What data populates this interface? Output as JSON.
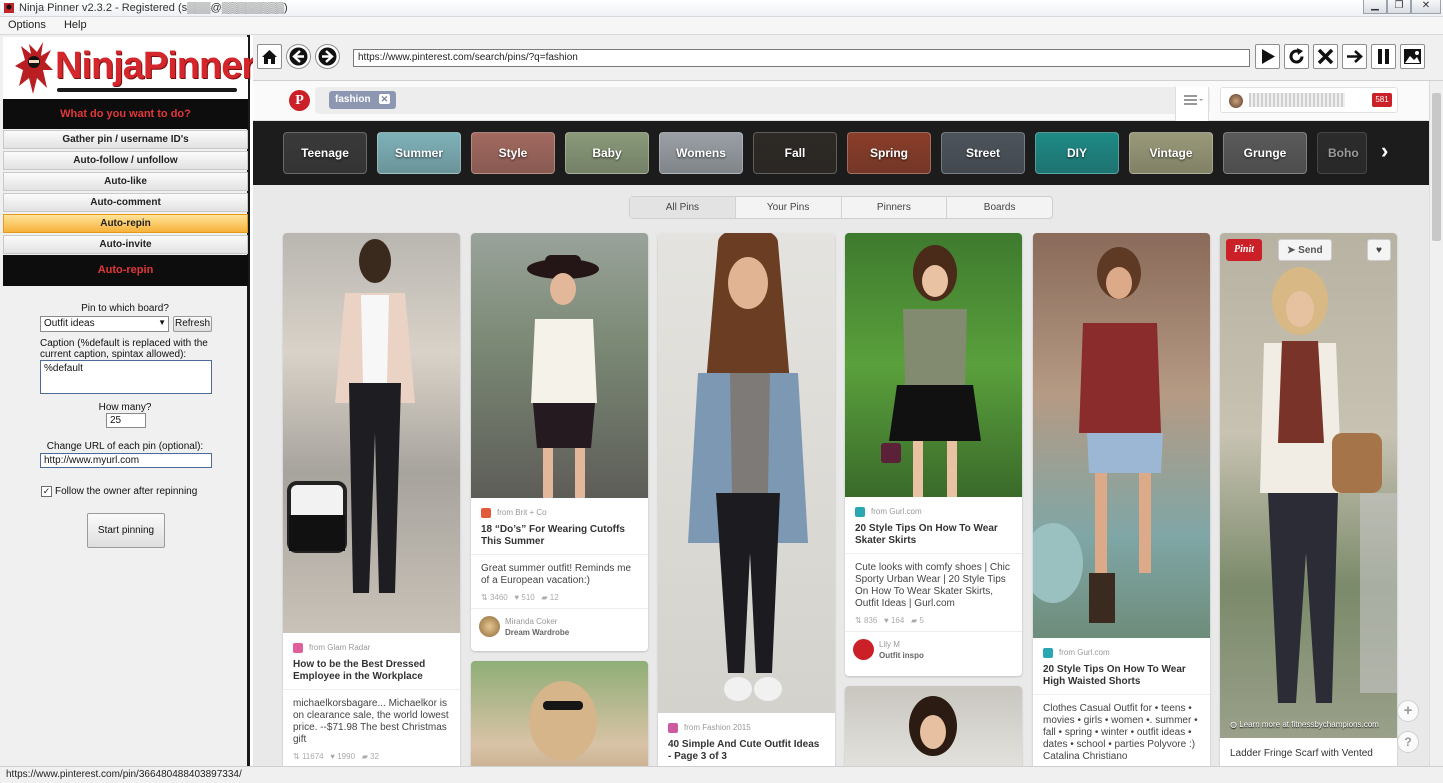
{
  "window": {
    "title": "Ninja Pinner v2.3.2 - Registered (s▒▒▒@▒▒▒▒▒▒▒▒)",
    "menu": [
      "Options",
      "Help"
    ]
  },
  "app": {
    "logo_text": "NinjaPinner",
    "prompt": "What do you want to do?",
    "actions": [
      "Gather pin / username ID's",
      "Auto-follow / unfollow",
      "Auto-like",
      "Auto-comment",
      "Auto-repin",
      "Auto-invite"
    ],
    "active_action": "Auto-repin",
    "section_title": "Auto-repin",
    "form": {
      "board_label": "Pin to which board?",
      "board_value": "Outfit ideas",
      "refresh_label": "Refresh",
      "caption_label": "Caption (%default is replaced with the current caption, spintax allowed):",
      "caption_value": "%default",
      "count_label": "How many?",
      "count_value": "25",
      "url_label": "Change URL of each pin (optional):",
      "url_value": "http://www.myurl.com",
      "follow_label": "Follow the owner after repinning",
      "follow_checked": true,
      "start_label": "Start pinning"
    }
  },
  "browser": {
    "url": "https://www.pinterest.com/search/pins/?q=fashion",
    "status_url": "https://www.pinterest.com/pin/366480488403897334/"
  },
  "pinterest": {
    "logo": "P",
    "search_chip": "fashion",
    "notification_count": "581",
    "categories": [
      {
        "label": "Teenage",
        "color": "#3a3a3a"
      },
      {
        "label": "Summer",
        "color": "#7fb2b9"
      },
      {
        "label": "Style",
        "color": "#a36a60"
      },
      {
        "label": "Baby",
        "color": "#8a9a7a"
      },
      {
        "label": "Womens",
        "color": "#9aa0a6"
      },
      {
        "label": "Fall",
        "color": "#2e2a26"
      },
      {
        "label": "Spring",
        "color": "#8a3e2a"
      },
      {
        "label": "Street",
        "color": "#4d545c"
      },
      {
        "label": "DIY",
        "color": "#1f8a86"
      },
      {
        "label": "Vintage",
        "color": "#9a9a7a"
      },
      {
        "label": "Grunge",
        "color": "#5a5a5a"
      },
      {
        "label": "Boho",
        "color": "#3a3a3a"
      }
    ],
    "tabs": [
      "All Pins",
      "Your Pins",
      "Pinners",
      "Boards"
    ],
    "selected_tab": "All Pins",
    "pin_it_label": "Pinit",
    "send_label": "Send",
    "image_source_note": "Learn more at fitnessbychampions.com",
    "pins": [
      {
        "from": "from Glam Radar",
        "title": "How to be the Best Dressed Employee in the Workplace",
        "desc": "michaelkorsbagare... Michaelkor is on clearance sale, the world lowest price. --$71.98 The best Christmas gift",
        "repins": "11674",
        "likes": "1990",
        "comments": "32",
        "fav_color": "#e0609a"
      },
      {
        "from": "from Brit + Co",
        "title": "18 “Do’s” For Wearing Cutoffs This Summer",
        "desc": "Great summer outfit! Reminds me of a European vacation:)",
        "repins": "3460",
        "likes": "510",
        "comments": "12",
        "pinner_name": "Miranda Coker",
        "pinner_board": "Dream Wardrobe",
        "fav_color": "#e25a3a"
      },
      {
        "from": "from Fashion 2015",
        "title": "40 Simple And Cute Outfit Ideas - Page 3 of 3",
        "fav_color": "#d05aa0"
      },
      {
        "from": "from Gurl.com",
        "title": "20 Style Tips On How To Wear Skater Skirts",
        "desc": "Cute looks with comfy shoes | Chic Sporty Urban Wear | 20 Style Tips On How To Wear Skater Skirts, Outfit Ideas | Gurl.com",
        "repins": "836",
        "likes": "164",
        "comments": "5",
        "pinner_name": "Lily M",
        "pinner_board": "Outfit inspo",
        "fav_color": "#2aa7b0"
      },
      {
        "from": "from Gurl.com",
        "title": "20 Style Tips On How To Wear High Waisted Shorts",
        "desc": "Clothes Casual Outfit for • teens • movies • girls • women •. summer • fall • spring • winter • outfit ideas • dates • school • parties Polyvore :) Catalina Christiano",
        "fav_color": "#2aa7b0"
      },
      {
        "title": "Ladder Fringe Scarf with Vented"
      }
    ]
  }
}
